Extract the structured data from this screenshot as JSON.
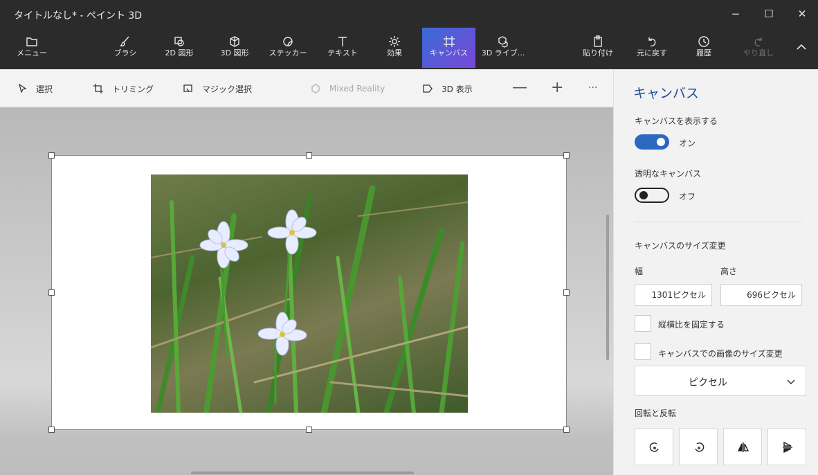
{
  "window": {
    "title": "タイトルなし* - ペイント 3D",
    "minimize": "−",
    "maximize": "☐",
    "close": "✕"
  },
  "ribbon": {
    "menu": {
      "label": "メニュー",
      "icon": "folder-icon"
    },
    "tools": [
      {
        "label": "ブラシ",
        "icon": "brush-icon"
      },
      {
        "label": "2D 図形",
        "icon": "2d-shapes-icon"
      },
      {
        "label": "3D 図形",
        "icon": "3d-shapes-icon"
      },
      {
        "label": "ステッカー",
        "icon": "sticker-icon"
      },
      {
        "label": "テキスト",
        "icon": "text-icon"
      },
      {
        "label": "効果",
        "icon": "effects-icon"
      },
      {
        "label": "キャンバス",
        "icon": "canvas-icon",
        "active": true
      },
      {
        "label": "3D ライブ...",
        "icon": "3d-library-icon"
      }
    ],
    "paste": {
      "label": "貼り付け",
      "icon": "paste-icon"
    },
    "undo": {
      "label": "元に戻す",
      "icon": "undo-icon"
    },
    "history": {
      "label": "履歴",
      "icon": "history-icon"
    },
    "redo": {
      "label": "やり直し",
      "icon": "redo-icon",
      "disabled": true
    }
  },
  "subtoolbar": {
    "select": "選択",
    "crop": "トリミング",
    "magic_select": "マジック選択",
    "mixed_reality": "Mixed Reality",
    "view3d": "3D 表示",
    "zoom_out": "—",
    "zoom_in": "+",
    "more": "···"
  },
  "panel": {
    "title": "キャンバス",
    "show_canvas": {
      "label": "キャンバスを表示する",
      "state": "オン",
      "on": true
    },
    "transparent_canvas": {
      "label": "透明なキャンバス",
      "state": "オフ",
      "on": false
    },
    "resize_title": "キャンバスのサイズ変更",
    "width_label": "幅",
    "height_label": "高さ",
    "width_value": "1301ピクセル",
    "height_value": "696ピクセル",
    "lock_aspect": {
      "label": "縦横比を固定する",
      "checked": false
    },
    "resize_image": {
      "label": "キャンバスでの画像のサイズ変更",
      "checked": false
    },
    "unit": "ピクセル",
    "rotate_title": "回転と反転",
    "rotate_buttons": [
      "rotate-left-icon",
      "rotate-right-icon",
      "flip-horizontal-icon",
      "flip-vertical-icon"
    ]
  },
  "colors": {
    "accent": "#2b69c0",
    "ribbon_bg": "#2b2b2b",
    "active_tab_start": "#3a6bd6",
    "active_tab_end": "#7a47d8"
  }
}
